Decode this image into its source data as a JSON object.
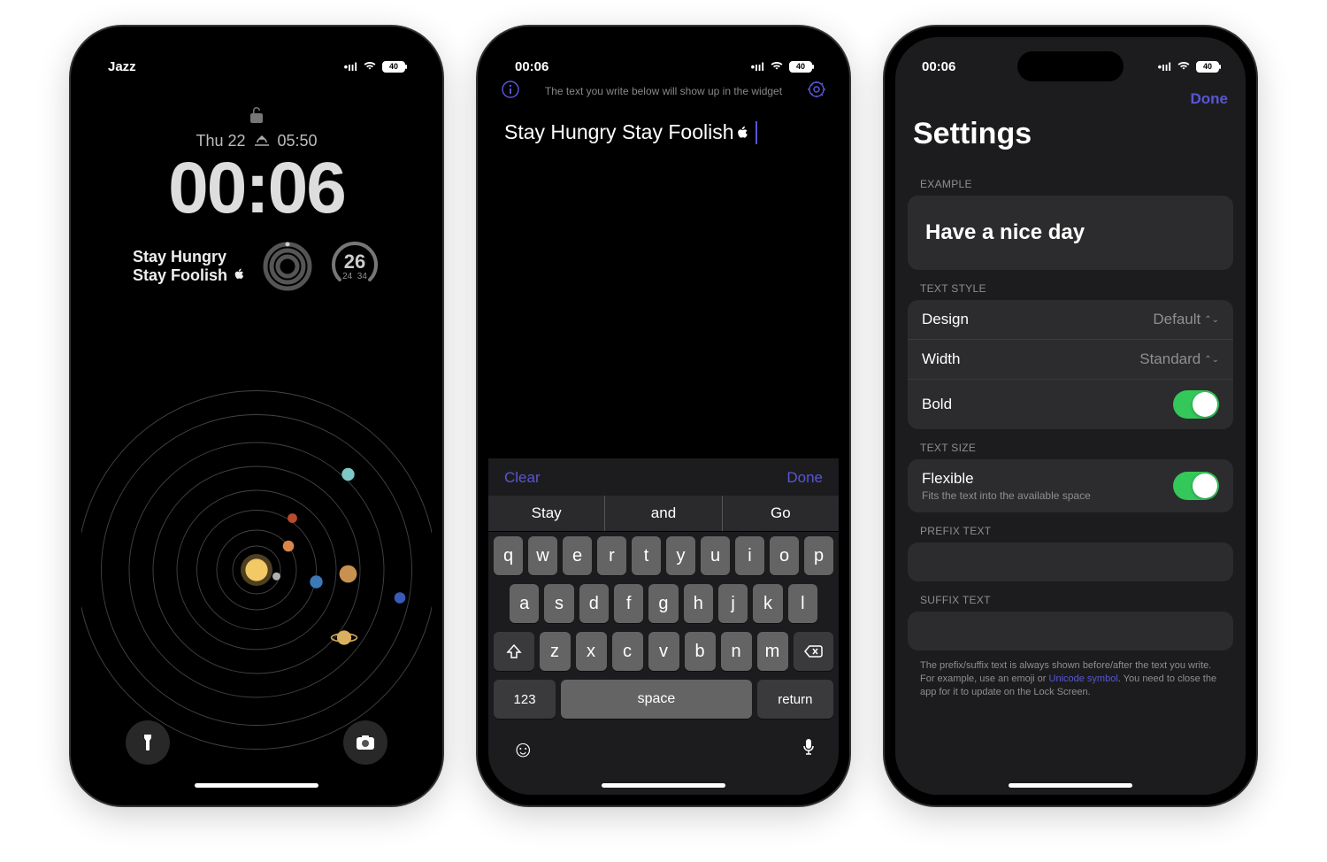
{
  "status": {
    "carrier": "Jazz",
    "time": "00:06",
    "battery": "40"
  },
  "p1": {
    "date": "Thu 22",
    "sun_time": "05:50",
    "time": "00:06",
    "widget_text_l1": "Stay Hungry",
    "widget_text_l2": "Stay Foolish ",
    "gauge": {
      "main": "26",
      "lo": "24",
      "hi": "34"
    }
  },
  "p2": {
    "hint": "The text you write below will show up in the widget",
    "value": "Stay Hungry Stay Foolish ",
    "clear": "Clear",
    "done": "Done",
    "sugg": [
      "Stay",
      "and",
      "Go"
    ],
    "rows": [
      [
        "q",
        "w",
        "e",
        "r",
        "t",
        "y",
        "u",
        "i",
        "o",
        "p"
      ],
      [
        "a",
        "s",
        "d",
        "f",
        "g",
        "h",
        "j",
        "k",
        "l"
      ],
      [
        "z",
        "x",
        "c",
        "v",
        "b",
        "n",
        "m"
      ]
    ],
    "num": "123",
    "space": "space",
    "return": "return"
  },
  "p3": {
    "done": "Done",
    "title": "Settings",
    "sections": {
      "example": {
        "label": "EXAMPLE",
        "value": "Have a nice day"
      },
      "text_style": {
        "label": "TEXT STYLE",
        "design": {
          "label": "Design",
          "value": "Default"
        },
        "width": {
          "label": "Width",
          "value": "Standard"
        },
        "bold": {
          "label": "Bold",
          "on": true
        }
      },
      "text_size": {
        "label": "TEXT SIZE",
        "flexible": {
          "label": "Flexible",
          "sub": "Fits the text into the available space",
          "on": true
        }
      },
      "prefix": {
        "label": "PREFIX TEXT"
      },
      "suffix": {
        "label": "SUFFIX TEXT"
      }
    },
    "footnote_a": "The prefix/suffix text is always shown before/after the text you write. For example, use an emoji or ",
    "footnote_link": "Unicode symbol",
    "footnote_b": ". You need to close the app for it to update on the Lock Screen."
  }
}
